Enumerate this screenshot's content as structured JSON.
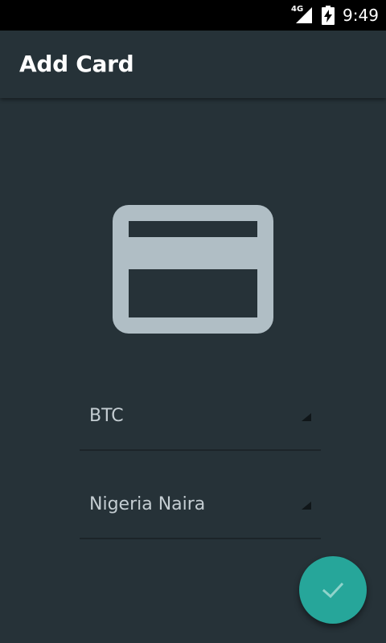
{
  "status_bar": {
    "network": "4G",
    "time": "9:49",
    "icons": [
      "signal-icon",
      "battery-charging-icon"
    ]
  },
  "app_bar": {
    "title": "Add Card"
  },
  "illustration": {
    "icon": "credit-card-icon",
    "color": "#b0bec5"
  },
  "form": {
    "crypto_select": {
      "selected": "BTC"
    },
    "fiat_select": {
      "selected": "Nigeria Naira"
    }
  },
  "fab": {
    "icon": "check-icon",
    "color": "#26a69a"
  },
  "theme": {
    "background": "#263238",
    "status_bar": "#000000",
    "text": "#c4cdd2"
  }
}
